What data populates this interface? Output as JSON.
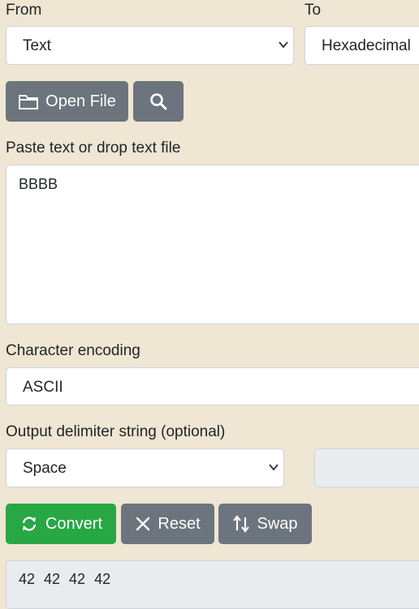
{
  "from": {
    "label": "From",
    "selected": "Text"
  },
  "to": {
    "label": "To",
    "selected": "Hexadecimal"
  },
  "open_file_label": "Open File",
  "paste_label": "Paste text or drop text file",
  "input_text": "BBBB",
  "encoding": {
    "label": "Character encoding",
    "value": "ASCII"
  },
  "delimiter": {
    "label": "Output delimiter string (optional)",
    "selected": "Space"
  },
  "buttons": {
    "convert": "Convert",
    "reset": "Reset",
    "swap": "Swap"
  },
  "output_text": "42 42 42 42",
  "colors": {
    "background": "#efe6d3",
    "gray_button": "#6c757d",
    "green_button": "#28a745",
    "readonly_field": "#e9ecef"
  }
}
